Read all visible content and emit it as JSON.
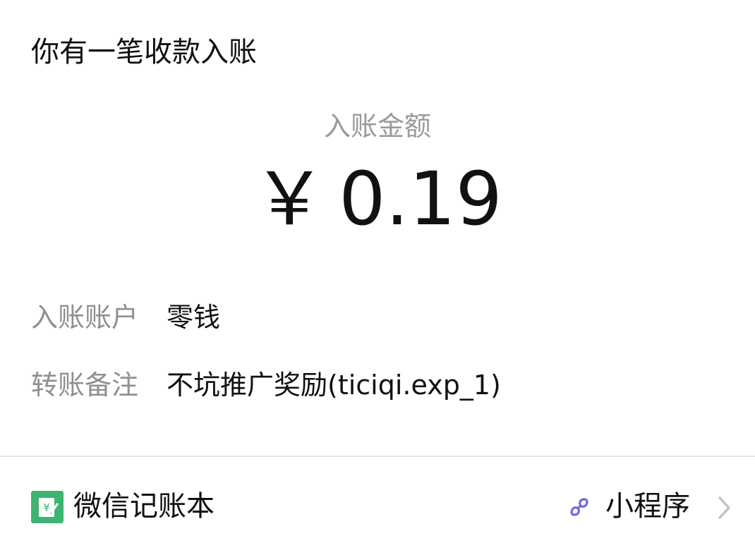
{
  "header": {
    "title": "你有一笔收款入账"
  },
  "amount": {
    "label": "入账金额",
    "currency": "￥",
    "value": "0.19"
  },
  "details": {
    "account_label": "入账账户",
    "account_value": "零钱",
    "note_label": "转账备注",
    "note_value": "不坑推广奖励(ticiqi.exp_1)"
  },
  "footer": {
    "app_name": "微信记账本",
    "mini_program_label": "小程序",
    "icons": {
      "app": "ledger-icon",
      "mini_program": "mini-program-icon",
      "chevron": "chevron-right-icon"
    }
  },
  "colors": {
    "background": "#ffffff",
    "primary_text": "#111111",
    "secondary_text": "#9a9a9a",
    "accent_green": "#3db472",
    "accent_purple": "#6b6bd8",
    "divider": "#e3e3e3",
    "chevron": "#c4c4c4"
  }
}
